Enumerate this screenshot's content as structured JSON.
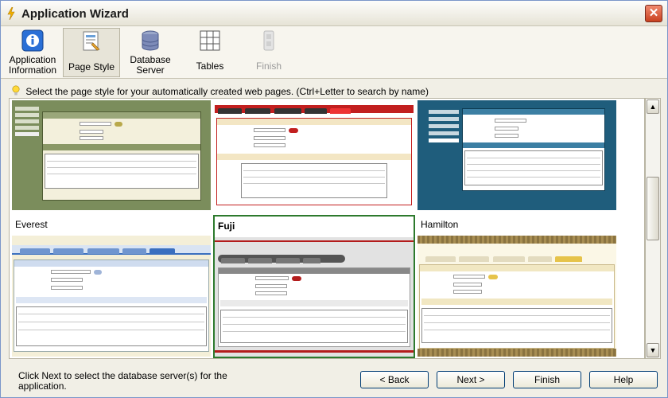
{
  "window": {
    "title": "Application Wizard"
  },
  "steps": [
    {
      "label": "Application Information",
      "icon": "info-icon",
      "state": "done"
    },
    {
      "label": "Page Style",
      "icon": "page-style-icon",
      "state": "active"
    },
    {
      "label": "Database Server",
      "icon": "database-icon",
      "state": "normal"
    },
    {
      "label": "Tables",
      "icon": "table-grid-icon",
      "state": "normal"
    },
    {
      "label": "Finish",
      "icon": "finish-icon",
      "state": "disabled"
    }
  ],
  "instruction": "Select the page style for your automatically created web pages. (Ctrl+Letter to search by name)",
  "styles": [
    {
      "name": "",
      "theme": "olive"
    },
    {
      "name": "",
      "theme": "red"
    },
    {
      "name": "",
      "theme": "blue"
    },
    {
      "name": "Everest",
      "theme": "everest"
    },
    {
      "name": "Fuji",
      "theme": "fuji",
      "selected": true
    },
    {
      "name": "Hamilton",
      "theme": "hamilton"
    }
  ],
  "status_text": "Click Next to select the database server(s) for the application.",
  "buttons": {
    "back": "< Back",
    "next": "Next >",
    "finish": "Finish",
    "help": "Help"
  },
  "colors": {
    "olive": "#7b8d5c",
    "red": "#c21f1f",
    "blue": "#1f5d7c",
    "everest": "#3a6fbf",
    "fuji": "#b31c1c",
    "hamilton": "#8a7340",
    "selected_border": "#2d7a2d"
  }
}
